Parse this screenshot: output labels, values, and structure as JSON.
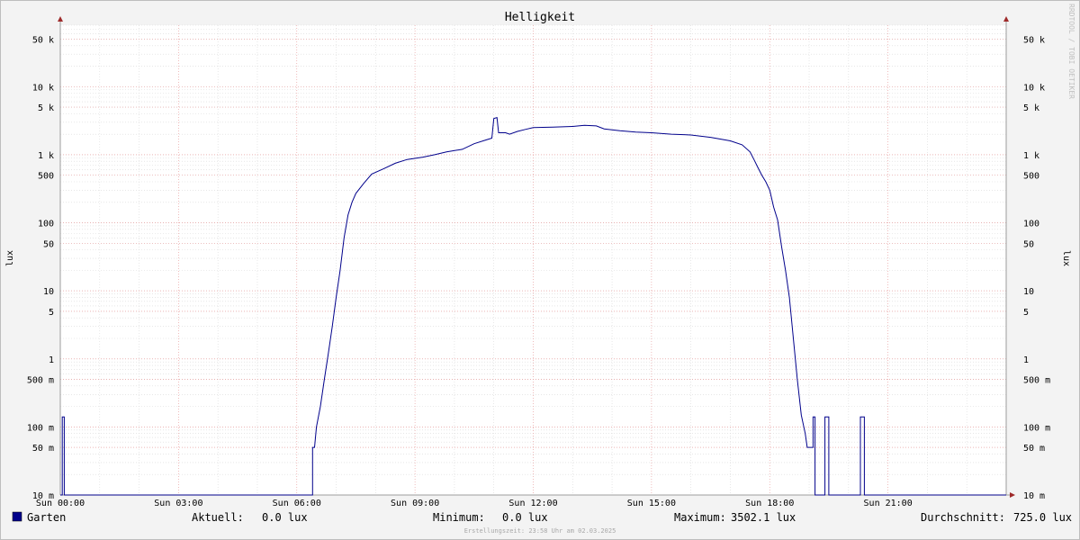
{
  "chart_data": {
    "type": "line",
    "title": "Helligkeit",
    "ylabel": "lux",
    "yscale": "log",
    "ylim": [
      0.01,
      80000
    ],
    "xlim_hours": [
      0,
      24
    ],
    "grid": true,
    "x_ticks": [
      {
        "hour": 0,
        "label": "Sun 00:00"
      },
      {
        "hour": 3,
        "label": "Sun 03:00"
      },
      {
        "hour": 6,
        "label": "Sun 06:00"
      },
      {
        "hour": 9,
        "label": "Sun 09:00"
      },
      {
        "hour": 12,
        "label": "Sun 12:00"
      },
      {
        "hour": 15,
        "label": "Sun 15:00"
      },
      {
        "hour": 18,
        "label": "Sun 18:00"
      },
      {
        "hour": 21,
        "label": "Sun 21:00"
      }
    ],
    "y_ticks": [
      {
        "value": 50000,
        "label": "50 k"
      },
      {
        "value": 10000,
        "label": "10 k"
      },
      {
        "value": 5000,
        "label": "5 k"
      },
      {
        "value": 1000,
        "label": "1 k"
      },
      {
        "value": 500,
        "label": "500"
      },
      {
        "value": 100,
        "label": "100"
      },
      {
        "value": 50,
        "label": "50"
      },
      {
        "value": 10,
        "label": "10"
      },
      {
        "value": 5,
        "label": "5"
      },
      {
        "value": 1,
        "label": "1"
      },
      {
        "value": 0.5,
        "label": "500 m"
      },
      {
        "value": 0.1,
        "label": "100 m"
      },
      {
        "value": 0.05,
        "label": "50 m"
      },
      {
        "value": 0.01,
        "label": "10 m"
      }
    ],
    "series": [
      {
        "name": "Garten",
        "color": "#00008b",
        "points": [
          [
            0.0,
            0.01
          ],
          [
            0.05,
            0.01
          ],
          [
            0.05,
            0.14
          ],
          [
            0.1,
            0.14
          ],
          [
            0.1,
            0.01
          ],
          [
            6.4,
            0.01
          ],
          [
            6.4,
            0.05
          ],
          [
            6.45,
            0.05
          ],
          [
            6.5,
            0.1
          ],
          [
            6.6,
            0.2
          ],
          [
            6.7,
            0.5
          ],
          [
            6.8,
            1.2
          ],
          [
            6.9,
            3
          ],
          [
            7.0,
            8
          ],
          [
            7.1,
            20
          ],
          [
            7.2,
            60
          ],
          [
            7.3,
            130
          ],
          [
            7.4,
            200
          ],
          [
            7.5,
            270
          ],
          [
            7.7,
            380
          ],
          [
            7.9,
            520
          ],
          [
            8.2,
            620
          ],
          [
            8.5,
            750
          ],
          [
            8.8,
            850
          ],
          [
            9.2,
            920
          ],
          [
            9.5,
            1000
          ],
          [
            9.8,
            1100
          ],
          [
            10.2,
            1200
          ],
          [
            10.5,
            1450
          ],
          [
            10.8,
            1650
          ],
          [
            10.95,
            1750
          ],
          [
            11.0,
            3400
          ],
          [
            11.08,
            3502.1
          ],
          [
            11.12,
            2100
          ],
          [
            11.3,
            2100
          ],
          [
            11.4,
            2000
          ],
          [
            11.6,
            2200
          ],
          [
            11.8,
            2350
          ],
          [
            12.0,
            2500
          ],
          [
            12.5,
            2550
          ],
          [
            13.0,
            2600
          ],
          [
            13.3,
            2700
          ],
          [
            13.6,
            2650
          ],
          [
            13.8,
            2400
          ],
          [
            14.2,
            2250
          ],
          [
            14.6,
            2150
          ],
          [
            15.0,
            2100
          ],
          [
            15.5,
            2000
          ],
          [
            16.0,
            1950
          ],
          [
            16.5,
            1800
          ],
          [
            17.0,
            1600
          ],
          [
            17.3,
            1400
          ],
          [
            17.5,
            1100
          ],
          [
            17.6,
            850
          ],
          [
            17.7,
            650
          ],
          [
            17.8,
            500
          ],
          [
            17.9,
            400
          ],
          [
            18.0,
            300
          ],
          [
            18.1,
            170
          ],
          [
            18.2,
            110
          ],
          [
            18.3,
            45
          ],
          [
            18.4,
            20
          ],
          [
            18.5,
            8
          ],
          [
            18.6,
            2
          ],
          [
            18.7,
            0.5
          ],
          [
            18.8,
            0.15
          ],
          [
            18.9,
            0.08
          ],
          [
            18.95,
            0.05
          ],
          [
            19.1,
            0.05
          ],
          [
            19.1,
            0.14
          ],
          [
            19.15,
            0.14
          ],
          [
            19.15,
            0.01
          ],
          [
            19.4,
            0.01
          ],
          [
            19.4,
            0.14
          ],
          [
            19.5,
            0.14
          ],
          [
            19.5,
            0.01
          ],
          [
            20.3,
            0.01
          ],
          [
            20.3,
            0.14
          ],
          [
            20.4,
            0.14
          ],
          [
            20.4,
            0.01
          ],
          [
            24.0,
            0.01
          ]
        ]
      }
    ]
  },
  "legend": {
    "series_label": "Garten",
    "color": "#00008b",
    "current_label": "Aktuell:",
    "current_value": "0.0 lux",
    "min_label": "Minimum:",
    "min_value": "0.0 lux",
    "max_label": "Maximum:",
    "max_value": "3502.1 lux",
    "avg_label": "Durchschnitt:",
    "avg_value": "725.0 lux"
  },
  "watermark": "RRDTOOL / TOBI OETIKER",
  "footer": "Erstellungszeit: 23:58 Uhr am 02.03.2025"
}
